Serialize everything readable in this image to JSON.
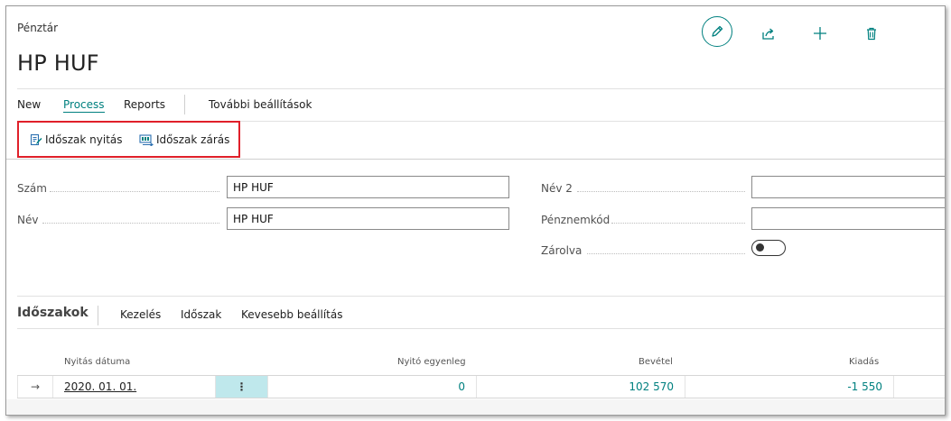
{
  "header": {
    "breadcrumb": "Pénztár",
    "title": "HP HUF"
  },
  "top_actions": {
    "edit_icon": "pencil-icon",
    "share_icon": "share-icon",
    "add_icon": "plus-icon",
    "delete_icon": "trash-icon"
  },
  "action_bar": {
    "new": "New",
    "process": "Process",
    "reports": "Reports",
    "more": "További beállítások"
  },
  "process_actions": {
    "open_period": "Időszak nyitás",
    "close_period": "Időszak zárás"
  },
  "fields": {
    "szam": {
      "label": "Szám",
      "value": "HP HUF"
    },
    "nev": {
      "label": "Név",
      "value": "HP HUF"
    },
    "nev2": {
      "label": "Név 2",
      "value": ""
    },
    "penznemkod": {
      "label": "Pénznemkód",
      "value": ""
    },
    "zarolva": {
      "label": "Zárolva",
      "value": "off"
    }
  },
  "subpage": {
    "title": "Időszakok",
    "manage": "Kezelés",
    "period": "Időszak",
    "fewer": "Kevesebb beállítás"
  },
  "table": {
    "columns": [
      "Nyitás dátuma",
      "Nyitó egyenleg",
      "Bevétel",
      "Kiadás"
    ],
    "rows": [
      {
        "arrow": "→",
        "date": "2020. 01. 01.",
        "menu": "⋮",
        "opening": "0",
        "income": "102 570",
        "expense": "-1 550"
      }
    ]
  },
  "colors": {
    "accent": "#00807f",
    "highlight_border": "#e0202a",
    "row_menu_bg": "#bfe8ec"
  }
}
